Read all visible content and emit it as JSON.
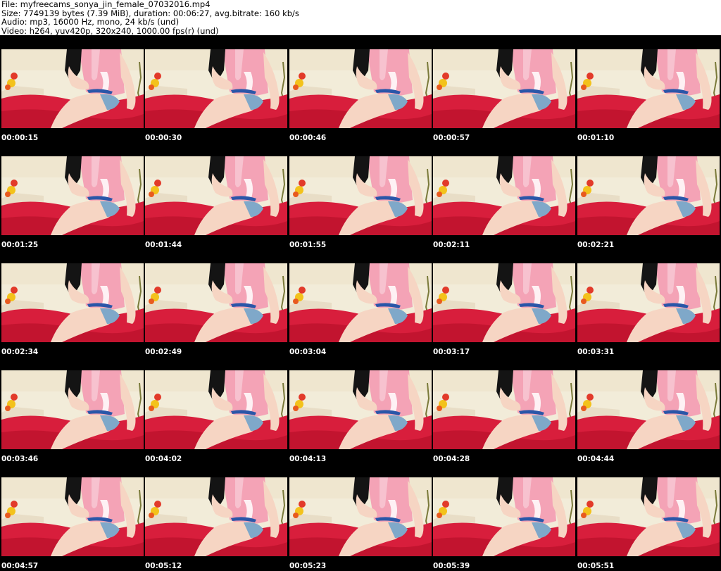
{
  "header": {
    "file_line": "File: myfreecams_sonya_jin_female_07032016.mp4",
    "size_line": "Size: 7749139 bytes (7.39 MiB), duration: 00:06:27, avg.bitrate: 160 kb/s",
    "audio_line": "Audio: mp3, 16000 Hz, mono, 24 kb/s (und)",
    "video_line": "Video: h264, yuv420p, 320x240, 1000.00 fps(r) (und)"
  },
  "grid": {
    "columns": 5,
    "rows": 5
  },
  "thumbnails": [
    {
      "timestamp": "00:00:15"
    },
    {
      "timestamp": "00:00:30"
    },
    {
      "timestamp": "00:00:46"
    },
    {
      "timestamp": "00:00:57"
    },
    {
      "timestamp": "00:01:10"
    },
    {
      "timestamp": "00:01:25"
    },
    {
      "timestamp": "00:01:44"
    },
    {
      "timestamp": "00:01:55"
    },
    {
      "timestamp": "00:02:11"
    },
    {
      "timestamp": "00:02:21"
    },
    {
      "timestamp": "00:02:34"
    },
    {
      "timestamp": "00:02:49"
    },
    {
      "timestamp": "00:03:04"
    },
    {
      "timestamp": "00:03:17"
    },
    {
      "timestamp": "00:03:31"
    },
    {
      "timestamp": "00:03:46"
    },
    {
      "timestamp": "00:04:02"
    },
    {
      "timestamp": "00:04:13"
    },
    {
      "timestamp": "00:04:28"
    },
    {
      "timestamp": "00:04:44"
    },
    {
      "timestamp": "00:04:57"
    },
    {
      "timestamp": "00:05:12"
    },
    {
      "timestamp": "00:05:23"
    },
    {
      "timestamp": "00:05:39"
    },
    {
      "timestamp": "00:05:51"
    }
  ],
  "colors": {
    "sheet_background": "#000000",
    "page_background": "#ffffff",
    "timestamp_text": "#ffffff",
    "bed_red": "#d81e3c",
    "shirt_pink": "#f4a3b6",
    "hair_black": "#141414",
    "skin": "#f6d5c3",
    "wall": "#f2ecd9"
  }
}
